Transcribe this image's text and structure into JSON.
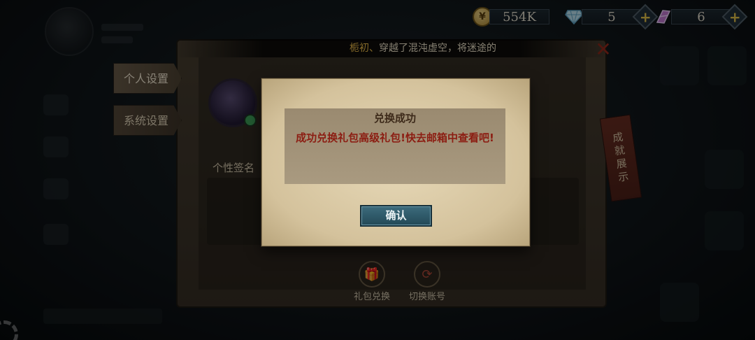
{
  "resources": {
    "coin": {
      "value": "554K",
      "icon": "coin-icon"
    },
    "diamond": {
      "value": "5",
      "icon": "diamond-icon"
    },
    "crystal": {
      "value": "6",
      "icon": "crystal-icon"
    }
  },
  "marquee": {
    "player_name": "栀初、",
    "message": "穿越了混沌虚空，将迷途的"
  },
  "settings_panel": {
    "tabs": [
      {
        "label": "个人设置",
        "active": true
      },
      {
        "label": "系统设置",
        "active": false
      }
    ],
    "signature_label": "个性签名",
    "side_ribbon_label": "成就展示",
    "bottom_buttons": [
      {
        "label": "礼包兑换",
        "icon": "gift-icon"
      },
      {
        "label": "切换账号",
        "icon": "switch-account-icon"
      }
    ]
  },
  "dialog": {
    "title": "兑换成功",
    "message": "成功兑换礼包高级礼包!快去邮箱中查看吧!",
    "confirm_label": "确认"
  },
  "colors": {
    "gold_text": "#f1c04b",
    "dialog_message": "#8c1d12",
    "confirm_button": "#2f5b6b",
    "parchment": "#dccba6"
  }
}
